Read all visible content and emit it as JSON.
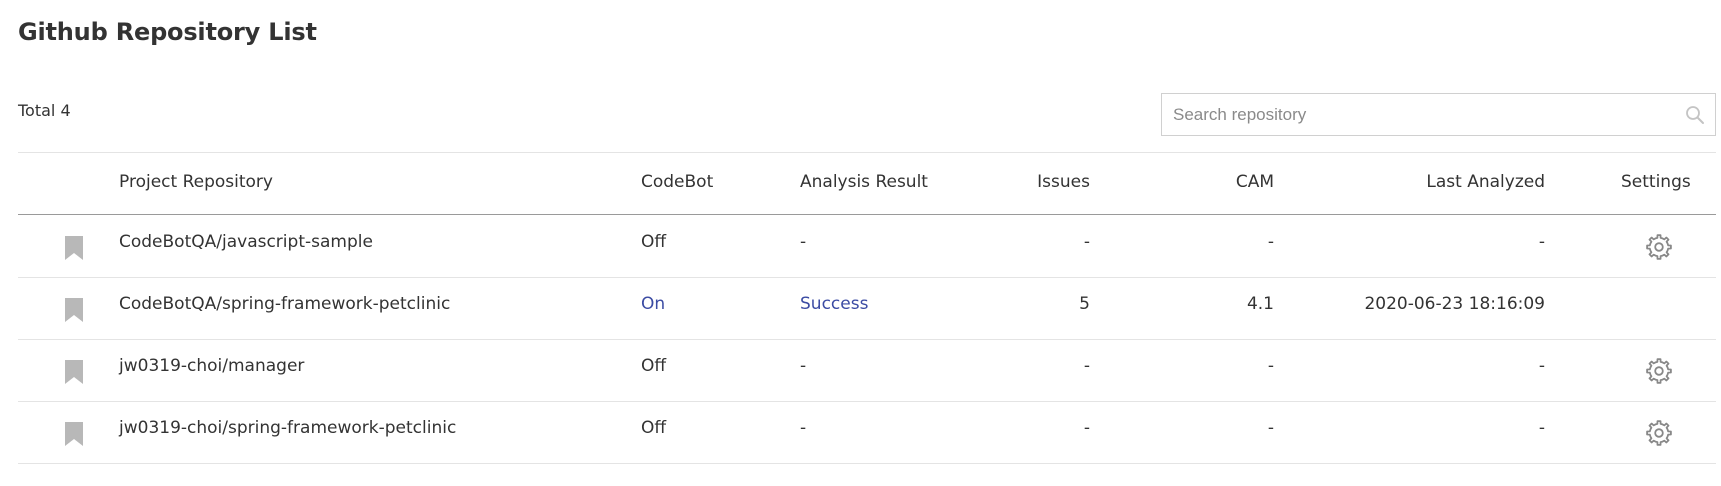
{
  "page": {
    "title": "Github Repository List",
    "total_label": "Total 4"
  },
  "search": {
    "placeholder": "Search repository",
    "icon": "search-icon"
  },
  "table": {
    "columns": [
      "Project Repository",
      "CodeBot",
      "Analysis Result",
      "Issues",
      "CAM",
      "Last Analyzed",
      "Settings"
    ],
    "rows": [
      {
        "repository": "CodeBotQA/javascript-sample",
        "codebot": "Off",
        "analysis_result": "-",
        "issues": "-",
        "cam": "-",
        "last_analyzed": "-",
        "has_settings": true
      },
      {
        "repository": "CodeBotQA/spring-framework-petclinic",
        "codebot": "On",
        "analysis_result": "Success",
        "issues": "5",
        "cam": "4.1",
        "last_analyzed": "2020-06-23 18:16:09",
        "has_settings": false
      },
      {
        "repository": "jw0319-choi/manager",
        "codebot": "Off",
        "analysis_result": "-",
        "issues": "-",
        "cam": "-",
        "last_analyzed": "-",
        "has_settings": true
      },
      {
        "repository": "jw0319-choi/spring-framework-petclinic",
        "codebot": "Off",
        "analysis_result": "-",
        "issues": "-",
        "cam": "-",
        "last_analyzed": "-",
        "has_settings": true
      }
    ]
  },
  "colors": {
    "link": "#3b4ba3",
    "text": "#333333",
    "icon": "#888888",
    "bookmark": "#b8b8b8"
  }
}
